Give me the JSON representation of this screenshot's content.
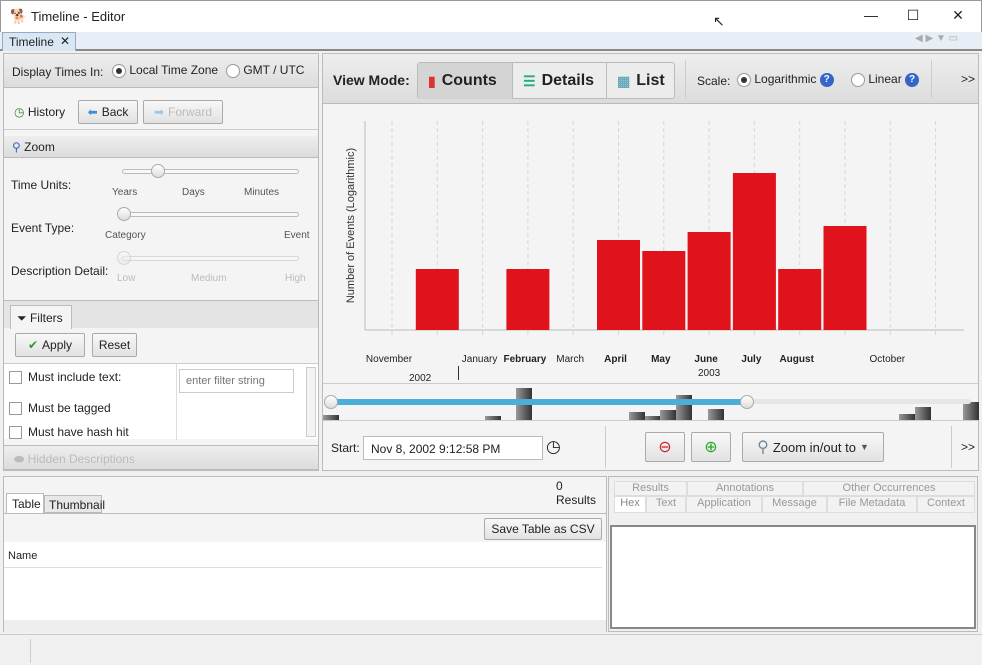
{
  "window": {
    "title": "Timeline - Editor",
    "tab": "Timeline"
  },
  "left": {
    "display_times_label": "Display Times In:",
    "local_tz": "Local Time Zone",
    "gmt": "GMT / UTC",
    "selected_tz": "Local Time Zone",
    "history": "History",
    "back": "Back",
    "forward": "Forward",
    "zoom_header": "Zoom",
    "time_units_label": "Time Units:",
    "time_units_ticks": [
      "Years",
      "Days",
      "Minutes"
    ],
    "time_units_value": "Years (position 1 of 7)",
    "event_type_label": "Event Type:",
    "event_type_ticks": [
      "Category",
      "Event"
    ],
    "event_type_value": "Category",
    "desc_detail_label": "Description Detail:",
    "desc_detail_ticks": [
      "Low",
      "Medium",
      "High"
    ],
    "filters_tab": "Filters",
    "apply": "Apply",
    "reset": "Reset",
    "filters": [
      {
        "label": "Must include text:",
        "checked": false
      },
      {
        "label": "Must be tagged",
        "checked": false
      },
      {
        "label": "Must have hash hit",
        "checked": false
      }
    ],
    "filter_placeholder": "enter filter string",
    "hidden_descriptions": "Hidden Descriptions"
  },
  "toolbar": {
    "view_mode_label": "View Mode:",
    "modes": [
      "Counts",
      "Details",
      "List"
    ],
    "active_mode": "Counts",
    "scale_label": "Scale:",
    "log": "Logarithmic",
    "linear": "Linear",
    "selected_scale": "Logarithmic",
    "more": ">>"
  },
  "chart_data": {
    "type": "bar",
    "scale": "log",
    "ylabel": "Number of Events (Logarithmic)",
    "grid": true,
    "categories": [
      "December 2002",
      "February 2003",
      "April 2003",
      "May 2003",
      "June 2003",
      "July 2003",
      "August 2003",
      "September 2003"
    ],
    "values": [
      61,
      61,
      90,
      79,
      98,
      157,
      61,
      104
    ],
    "values_note": "relative log-scale heights; axis prints no tick values",
    "color": "#e0121c",
    "month_labels": [
      {
        "t": "November",
        "b": false
      },
      {
        "t": "January",
        "b": false
      },
      {
        "t": "February",
        "b": true
      },
      {
        "t": "March",
        "b": false
      },
      {
        "t": "April",
        "b": true
      },
      {
        "t": "May",
        "b": true
      },
      {
        "t": "June",
        "b": true
      },
      {
        "t": "July",
        "b": true
      },
      {
        "t": "August",
        "b": true
      },
      {
        "t": "October",
        "b": false
      }
    ],
    "year_labels": [
      "2002",
      "2003"
    ]
  },
  "range": {
    "start_fraction": 0,
    "end_fraction": 0.65
  },
  "bottom_toolbar": {
    "start_label": "Start:",
    "start_value": "Nov 8, 2002 9:12:58 PM",
    "zoom_to": "Zoom in/out to",
    "more": ">>"
  },
  "results": {
    "count": "0",
    "label": "Results",
    "tabs": [
      "Table",
      "Thumbnail"
    ],
    "save_csv": "Save Table as CSV",
    "column": "Name"
  },
  "viewer": {
    "top_tabs": [
      "Results",
      "Annotations",
      "Other Occurrences"
    ],
    "tabs": [
      "Hex",
      "Text",
      "Application",
      "Message",
      "File Metadata",
      "Context"
    ],
    "active": "Hex"
  }
}
